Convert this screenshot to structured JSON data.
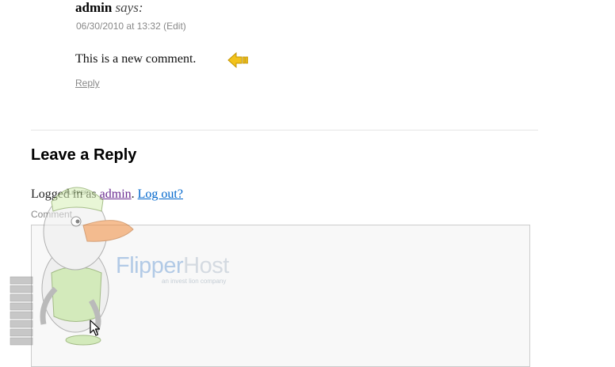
{
  "comment": {
    "author": "admin",
    "says": "says:",
    "date": "06/30/2010 at 13:32",
    "edit_label": "(Edit)",
    "text": "This is a new comment.",
    "reply_label": "Reply"
  },
  "reply_form": {
    "title": "Leave a Reply",
    "logged_in_prefix": "Logged in as",
    "username": "admin",
    "separator": ".",
    "logout_label": "Log out?",
    "comment_label": "Comment",
    "comment_value": ""
  },
  "overlay": {
    "mascot_cap_text": "FLIPPER",
    "logo_name_part1": "Flipper",
    "logo_name_part2": "Host",
    "logo_tagline": "an invest lion company"
  },
  "icons": {
    "arrow": "arrow-left-icon",
    "cursor": "mouse-cursor-icon"
  },
  "colors": {
    "arrow_fill": "#f2c21b",
    "user_link": "#6b2c91",
    "logout_link": "#0066cc"
  }
}
